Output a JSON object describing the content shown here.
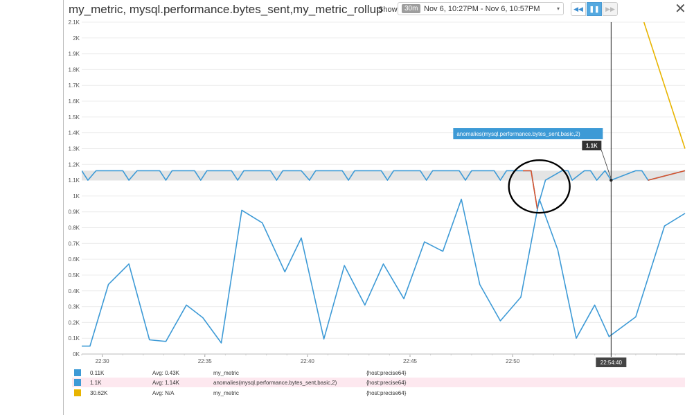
{
  "header": {
    "title": "my_metric, mysql.performance.bytes_sent,my_metric_rollup",
    "show_label": "Show",
    "time_badge": "30m",
    "time_range": "Nov 6, 10:27PM - Nov 6, 10:57PM",
    "caret": "▾",
    "back_icon": "◀◀",
    "pause_icon": "❚❚",
    "forward_icon": "▶▶",
    "close_icon": "✕"
  },
  "chart_data": {
    "type": "line",
    "x_unit": "clock time (HH:MM)",
    "ylim": [
      0,
      2100
    ],
    "yticks": [
      {
        "v": 0,
        "label": "0K"
      },
      {
        "v": 100,
        "label": "0.1K"
      },
      {
        "v": 200,
        "label": "0.2K"
      },
      {
        "v": 300,
        "label": "0.3K"
      },
      {
        "v": 400,
        "label": "0.4K"
      },
      {
        "v": 500,
        "label": "0.5K"
      },
      {
        "v": 600,
        "label": "0.6K"
      },
      {
        "v": 700,
        "label": "0.7K"
      },
      {
        "v": 800,
        "label": "0.8K"
      },
      {
        "v": 900,
        "label": "0.9K"
      },
      {
        "v": 1000,
        "label": "1K"
      },
      {
        "v": 1100,
        "label": "1.1K"
      },
      {
        "v": 1200,
        "label": "1.2K"
      },
      {
        "v": 1300,
        "label": "1.3K"
      },
      {
        "v": 1400,
        "label": "1.4K"
      },
      {
        "v": 1500,
        "label": "1.5K"
      },
      {
        "v": 1600,
        "label": "1.6K"
      },
      {
        "v": 1700,
        "label": "1.7K"
      },
      {
        "v": 1800,
        "label": "1.8K"
      },
      {
        "v": 1900,
        "label": "1.9K"
      },
      {
        "v": 2000,
        "label": "2K"
      },
      {
        "v": 2100,
        "label": "2.1K"
      }
    ],
    "xlim": [
      1349.0,
      1378.4
    ],
    "xticks": [
      {
        "v": 1350,
        "label": "22:30"
      },
      {
        "v": 1355,
        "label": "22:35"
      },
      {
        "v": 1360,
        "label": "22:40"
      },
      {
        "v": 1365,
        "label": "22:45"
      },
      {
        "v": 1370,
        "label": "22:50"
      }
    ],
    "band": {
      "lower": 1100,
      "upper": 1160
    },
    "series": [
      {
        "name": "my_metric",
        "color": "#3d9ad6",
        "x": [
          1349.0,
          1349.4,
          1350.3,
          1351.3,
          1352.3,
          1353.1,
          1354.1,
          1354.9,
          1355.8,
          1356.8,
          1357.8,
          1358.9,
          1359.7,
          1360.8,
          1361.8,
          1362.8,
          1363.7,
          1364.7,
          1365.7,
          1366.6,
          1367.5,
          1368.4,
          1369.4,
          1370.4,
          1371.3,
          1372.2,
          1373.1,
          1374.0,
          1374.7,
          1376.0,
          1377.4,
          1378.4
        ],
        "y": [
          50,
          50,
          440,
          570,
          90,
          80,
          310,
          230,
          70,
          910,
          830,
          520,
          735,
          95,
          560,
          310,
          570,
          350,
          710,
          650,
          980,
          440,
          210,
          360,
          980,
          660,
          100,
          310,
          110,
          235,
          810,
          890
        ]
      },
      {
        "name": "anomalies(mysql.performance.bytes_sent,basic,2)",
        "color": "#3d9ad6",
        "anomaly_color": "#d9532c",
        "x": [
          1349.0,
          1349.3,
          1349.7,
          1351.0,
          1351.3,
          1351.7,
          1352.8,
          1353.1,
          1353.4,
          1354.5,
          1354.8,
          1355.1,
          1356.3,
          1356.6,
          1356.9,
          1358.2,
          1358.5,
          1358.8,
          1359.7,
          1360.1,
          1360.4,
          1361.7,
          1362.0,
          1362.3,
          1363.6,
          1363.9,
          1364.2,
          1365.5,
          1365.8,
          1366.1,
          1367.4,
          1367.7,
          1368.0,
          1369.1,
          1369.4,
          1369.7,
          1370.5,
          1370.9,
          1371.2,
          1371.6,
          1372.4,
          1372.7,
          1372.9,
          1373.5,
          1373.8,
          1374.1,
          1374.5,
          1374.8,
          1376.0,
          1376.3,
          1376.6,
          1378.4
        ],
        "y": [
          1160,
          1100,
          1160,
          1160,
          1100,
          1160,
          1160,
          1100,
          1160,
          1160,
          1100,
          1160,
          1160,
          1100,
          1160,
          1160,
          1100,
          1160,
          1160,
          1100,
          1160,
          1160,
          1100,
          1160,
          1160,
          1100,
          1160,
          1160,
          1100,
          1160,
          1160,
          1100,
          1160,
          1160,
          1100,
          1160,
          1160,
          1160,
          920,
          1100,
          1160,
          1160,
          1100,
          1160,
          1160,
          1100,
          1160,
          1100,
          1160,
          1160,
          1100,
          1160
        ],
        "anomaly_ranges": [
          [
            1370.5,
            1371.2
          ],
          [
            1376.6,
            1378.4
          ]
        ]
      },
      {
        "name": "my_metric_rollup",
        "color": "#e8b400",
        "x": [
          1376.4,
          1378.4
        ],
        "y": [
          2100,
          1300
        ]
      }
    ],
    "crosshair": {
      "x": 1374.8,
      "label": "22:54:40",
      "value_label": "1.1K",
      "series_label": "anomalies(mysql.performance.bytes_sent,basic,2)"
    },
    "annotation": {
      "type": "ellipse",
      "cx": 1371.3,
      "cy": 1060
    }
  },
  "legend": [
    {
      "color": "#3d9ad6",
      "value": "0.11K",
      "avg": "Avg: 0.43K",
      "metric": "my_metric",
      "tags": "{host:precise64}"
    },
    {
      "color": "#3d9ad6",
      "value": "1.1K",
      "avg": "Avg: 1.14K",
      "metric": "anomalies(mysql.performance.bytes_sent,basic,2)",
      "tags": "{host:precise64}"
    },
    {
      "color": "#e8b400",
      "value": "30.62K",
      "avg": "Avg: N/A",
      "metric": "my_metric",
      "tags": "{host:precise64}"
    }
  ]
}
